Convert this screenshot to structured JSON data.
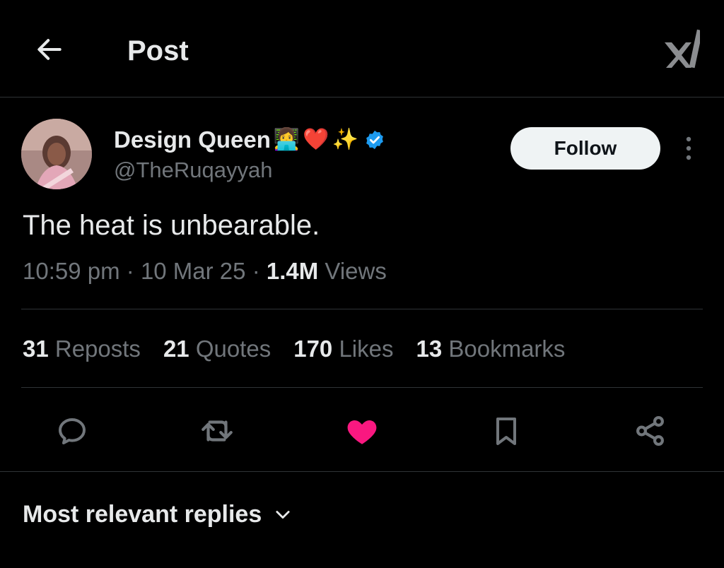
{
  "header": {
    "title": "Post",
    "back_icon": "arrow-left-icon",
    "grok_icon": "grok-icon"
  },
  "author": {
    "name": "Design Queen",
    "emojis": [
      "👩‍💻",
      "❤️",
      "✨"
    ],
    "handle": "@TheRuqayyah",
    "verified": true,
    "follow_label": "Follow"
  },
  "tweet": {
    "text": "The heat is unbearable.",
    "time": "10:59 pm",
    "date": "10 Mar 25",
    "views_count": "1.4M",
    "views_label": "Views"
  },
  "stats": [
    {
      "count": "31",
      "label": "Reposts"
    },
    {
      "count": "21",
      "label": "Quotes"
    },
    {
      "count": "170",
      "label": "Likes"
    },
    {
      "count": "13",
      "label": "Bookmarks"
    }
  ],
  "actions": {
    "reply_icon": "reply-icon",
    "repost_icon": "repost-icon",
    "like_icon": "heart-icon",
    "bookmark_icon": "bookmark-icon",
    "share_icon": "share-icon",
    "liked": true,
    "like_color": "#f91880"
  },
  "replies": {
    "sort_label": "Most relevant replies"
  },
  "colors": {
    "background": "#000000",
    "text_primary": "#e7e9ea",
    "text_secondary": "#71767b",
    "divider": "#2f3336",
    "verified": "#1d9bf0"
  }
}
